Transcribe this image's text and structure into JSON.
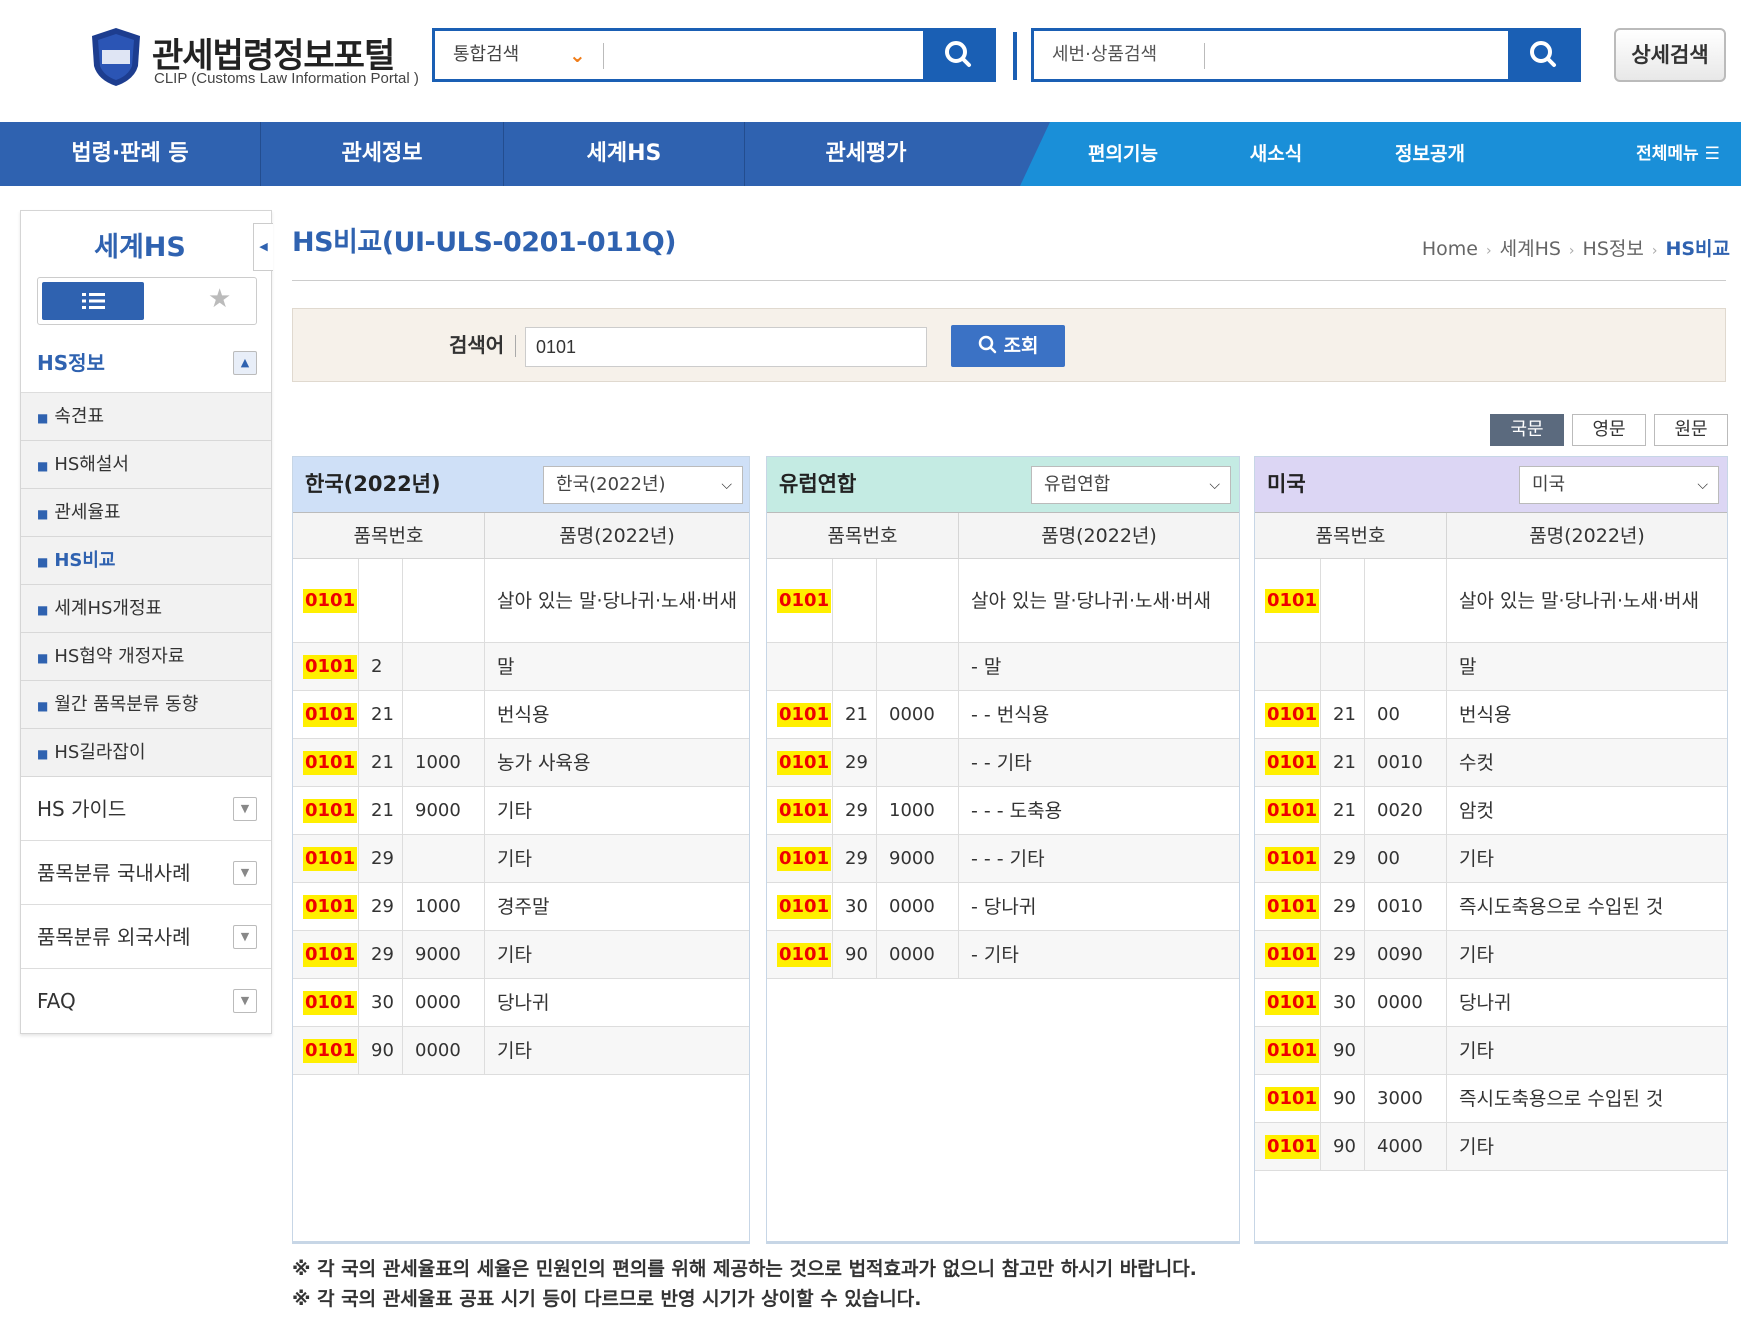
{
  "header": {
    "logo_title": "관세법령정보포털",
    "logo_sub": "CLIP (Customs Law Information Portal )",
    "search1_select": "통합검색",
    "search2_placeholder": "세번·상품검색",
    "detail_search": "상세검색"
  },
  "nav": {
    "main": [
      "법령·판례 등",
      "관세정보",
      "세계HS",
      "관세평가"
    ],
    "sub": [
      "편의기능",
      "새소식",
      "정보공개"
    ],
    "all_menu": "전체메뉴 ☰"
  },
  "sidebar": {
    "title": "세계HS",
    "section_open": "HS정보",
    "items": [
      "속견표",
      "HS해설서",
      "관세율표",
      "HS비교",
      "세계HS개정표",
      "HS협약 개정자료",
      "월간 품목분류 동향",
      "HS길라잡이"
    ],
    "active_index": 3,
    "sections": [
      "HS 가이드",
      "품목분류 국내사례",
      "품목분류 외국사례",
      "FAQ"
    ]
  },
  "page": {
    "title": "HS비교(UI-ULS-0201-011Q)",
    "breadcrumb": [
      "Home",
      "세계HS",
      "HS정보",
      "HS비교"
    ]
  },
  "search": {
    "label": "검색어",
    "value": "0101",
    "button": "조회"
  },
  "lang_tabs": [
    "국문",
    "영문",
    "원문"
  ],
  "lang_active": 0,
  "col_headers": {
    "code": "품목번호",
    "name": "품명(2022년)"
  },
  "panels": [
    {
      "name": "한국(2022년)",
      "select": "한국(2022년)",
      "color": "#cfe0f7",
      "rows": [
        {
          "hs": "0101",
          "s2": "",
          "s3": "",
          "name": "살아 있는 말·당나귀·노새·버새",
          "tall": true
        },
        {
          "hs": "0101",
          "s2": "2",
          "s3": "",
          "name": "말"
        },
        {
          "hs": "0101",
          "s2": "21",
          "s3": "",
          "name": "번식용"
        },
        {
          "hs": "0101",
          "s2": "21",
          "s3": "1000",
          "name": "농가 사육용"
        },
        {
          "hs": "0101",
          "s2": "21",
          "s3": "9000",
          "name": "기타"
        },
        {
          "hs": "0101",
          "s2": "29",
          "s3": "",
          "name": "기타"
        },
        {
          "hs": "0101",
          "s2": "29",
          "s3": "1000",
          "name": "경주말"
        },
        {
          "hs": "0101",
          "s2": "29",
          "s3": "9000",
          "name": "기타"
        },
        {
          "hs": "0101",
          "s2": "30",
          "s3": "0000",
          "name": "당나귀"
        },
        {
          "hs": "0101",
          "s2": "90",
          "s3": "0000",
          "name": "기타"
        }
      ]
    },
    {
      "name": "유럽연합",
      "select": "유럽연합",
      "color": "#c4ebe3",
      "rows": [
        {
          "hs": "0101",
          "s2": "",
          "s3": "",
          "name": "살아 있는 말·당나귀·노새·버새",
          "tall": true
        },
        {
          "hs": "",
          "s2": "",
          "s3": "",
          "name": "- 말"
        },
        {
          "hs": "0101",
          "s2": "21",
          "s3": "0000",
          "name": "- - 번식용"
        },
        {
          "hs": "0101",
          "s2": "29",
          "s3": "",
          "name": "- - 기타"
        },
        {
          "hs": "0101",
          "s2": "29",
          "s3": "1000",
          "name": "- - - 도축용"
        },
        {
          "hs": "0101",
          "s2": "29",
          "s3": "9000",
          "name": "- - - 기타"
        },
        {
          "hs": "0101",
          "s2": "30",
          "s3": "0000",
          "name": "- 당나귀"
        },
        {
          "hs": "0101",
          "s2": "90",
          "s3": "0000",
          "name": "- 기타"
        }
      ]
    },
    {
      "name": "미국",
      "select": "미국",
      "color": "#dcd6f4",
      "rows": [
        {
          "hs": "0101",
          "s2": "",
          "s3": "",
          "name": "살아 있는 말·당나귀·노새·버새",
          "tall": true
        },
        {
          "hs": "",
          "s2": "",
          "s3": "",
          "name": "말"
        },
        {
          "hs": "0101",
          "s2": "21",
          "s3": "00",
          "name": "번식용"
        },
        {
          "hs": "0101",
          "s2": "21",
          "s3": "0010",
          "name": "수컷"
        },
        {
          "hs": "0101",
          "s2": "21",
          "s3": "0020",
          "name": "암컷"
        },
        {
          "hs": "0101",
          "s2": "29",
          "s3": "00",
          "name": "기타"
        },
        {
          "hs": "0101",
          "s2": "29",
          "s3": "0010",
          "name": "즉시도축용으로 수입된 것"
        },
        {
          "hs": "0101",
          "s2": "29",
          "s3": "0090",
          "name": "기타"
        },
        {
          "hs": "0101",
          "s2": "30",
          "s3": "0000",
          "name": "당나귀"
        },
        {
          "hs": "0101",
          "s2": "90",
          "s3": "",
          "name": "기타"
        },
        {
          "hs": "0101",
          "s2": "90",
          "s3": "3000",
          "name": "즉시도축용으로 수입된 것"
        },
        {
          "hs": "0101",
          "s2": "90",
          "s3": "4000",
          "name": "기타"
        }
      ]
    }
  ],
  "notes": [
    "※ 각 국의 관세율표의 세율은 민원인의 편의를 위해 제공하는 것으로 법적효과가 없으니 참고만 하시기 바랍니다.",
    "※ 각 국의 관세율표 공표 시기 등이 다르므로 반영 시기가 상이할 수 있습니다."
  ]
}
